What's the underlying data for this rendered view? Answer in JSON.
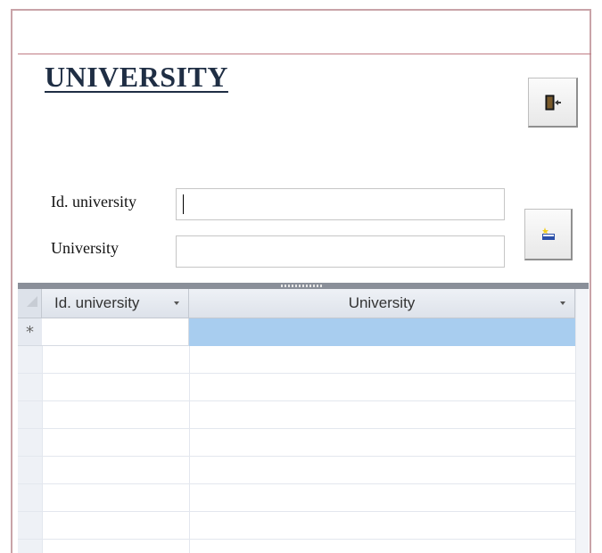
{
  "form": {
    "title": "UNIVERSITY"
  },
  "fields": {
    "id_label": "Id. university",
    "id_value": "",
    "university_label": "University",
    "university_value": ""
  },
  "buttons": {
    "exit_icon": "exit-door-icon",
    "new_icon": "new-record-icon"
  },
  "datasheet": {
    "columns": [
      {
        "label": "Id. university"
      },
      {
        "label": "University"
      }
    ],
    "new_row_marker": "*",
    "rows": []
  },
  "colors": {
    "title": "#1f2e44",
    "selection": "#a8cdef",
    "frame": "#c9a3a8"
  }
}
